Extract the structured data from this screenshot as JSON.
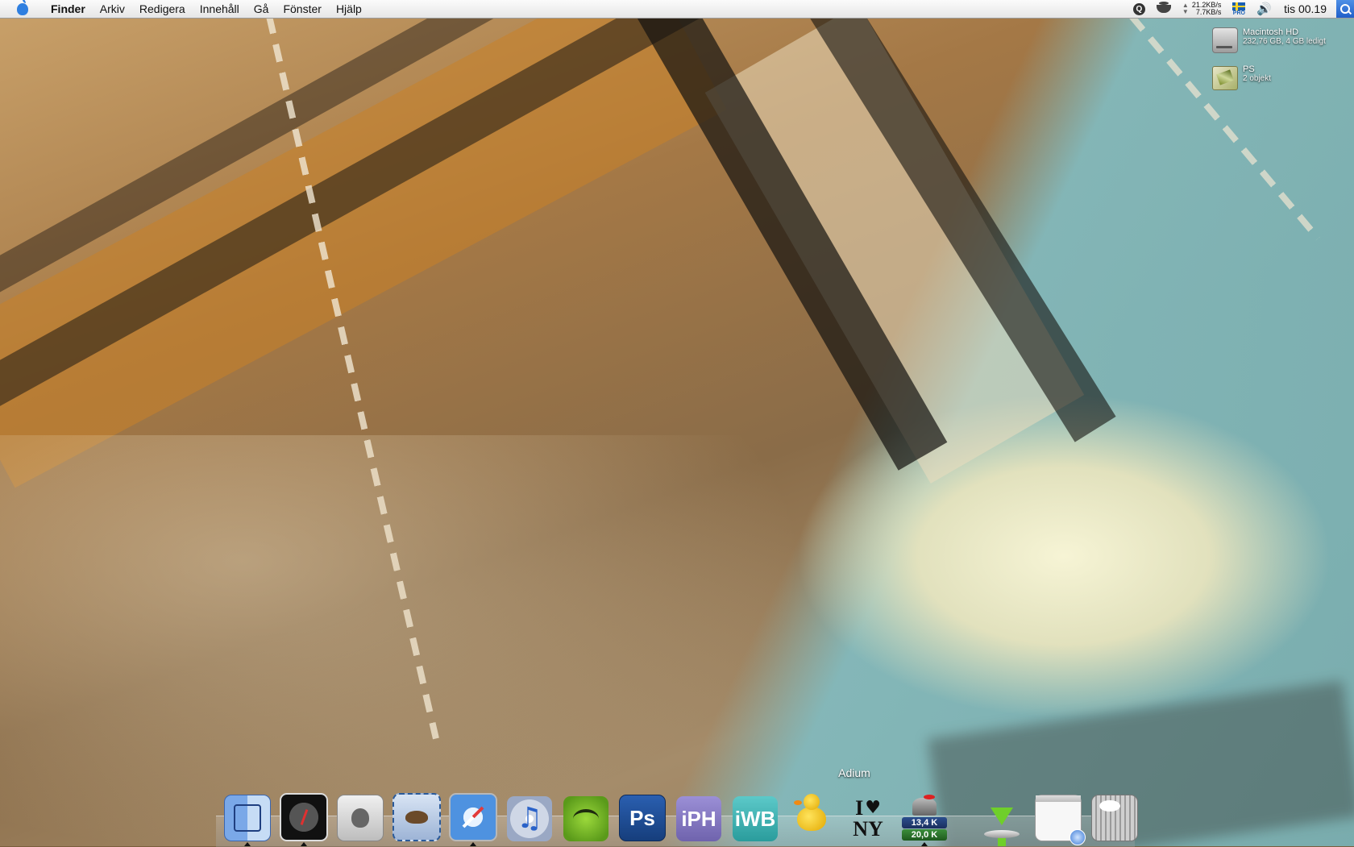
{
  "menubar": {
    "app_name": "Finder",
    "menus": [
      "Arkiv",
      "Redigera",
      "Innehåll",
      "Gå",
      "Fönster",
      "Hjälp"
    ],
    "network_up": "21.2KB/s",
    "network_down": "7.7KB/s",
    "flag_badge": "PRO",
    "clock": "tis 00.19",
    "extras_icons": [
      "quicksilver-icon",
      "coffee-cup-icon",
      "network-arrows-icon",
      "swedish-flag-icon",
      "speaker-icon",
      "spotlight-icon"
    ]
  },
  "desktop": {
    "icons": [
      {
        "name": "Macintosh HD",
        "subtitle": "232,76 GB, 4 GB ledigt",
        "icon": "hard-drive-icon"
      },
      {
        "name": "PS",
        "subtitle": "2 objekt",
        "icon": "ps-folder-icon"
      }
    ]
  },
  "dock": {
    "tooltip": "Adium",
    "items": [
      {
        "id": "finder",
        "icon": "finder-icon",
        "running": true
      },
      {
        "id": "dashboard",
        "icon": "dashboard-icon",
        "running": true
      },
      {
        "id": "system-preferences",
        "icon": "system-preferences-icon",
        "running": false
      },
      {
        "id": "mail",
        "icon": "mail-icon",
        "running": false
      },
      {
        "id": "safari",
        "icon": "safari-icon",
        "running": true
      },
      {
        "id": "itunes",
        "icon": "itunes-icon",
        "running": false
      },
      {
        "id": "spotify",
        "icon": "spotify-icon",
        "running": false
      },
      {
        "id": "photoshop",
        "icon": "photoshop-icon",
        "label": "Ps",
        "running": false
      },
      {
        "id": "iphoto-like",
        "icon": "iph-icon",
        "label": "iPH",
        "running": false
      },
      {
        "id": "iweb-like",
        "icon": "iwb-icon",
        "label": "iWB",
        "running": false
      },
      {
        "id": "adium",
        "icon": "adium-duck-icon",
        "running": false
      },
      {
        "id": "i-love-ny",
        "icon": "i-love-ny-icon",
        "label_i": "I",
        "label_heart": "♥",
        "label_ny": "NY",
        "running": false
      },
      {
        "id": "network-monitor",
        "icon": "network-monitor-icon",
        "up": "13,4 K",
        "down": "20,0 K",
        "running": true
      }
    ],
    "right_items": [
      {
        "id": "downloads",
        "icon": "downloads-icon"
      },
      {
        "id": "safari-window",
        "icon": "safari-window-icon"
      },
      {
        "id": "trash",
        "icon": "trash-icon"
      }
    ]
  },
  "colors": {
    "menubar_bg": "#eeeeee",
    "spotlight_blue": "#2f6fd6",
    "apple_blue": "#2f7fe0"
  }
}
